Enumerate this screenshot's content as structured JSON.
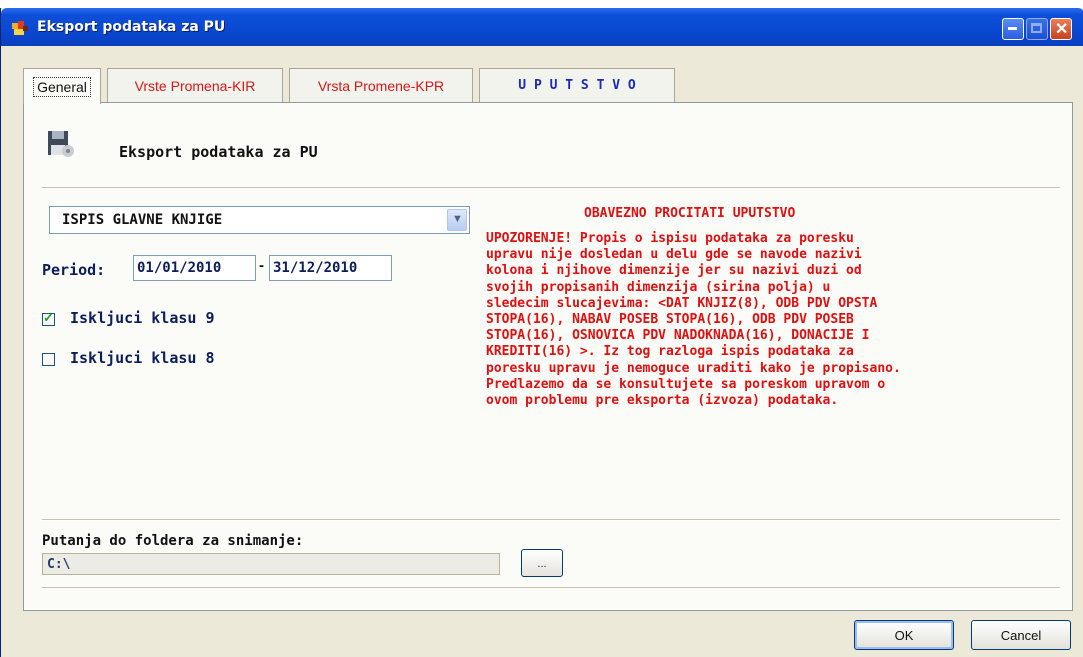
{
  "window": {
    "title": "Eksport podataka za PU"
  },
  "tabs": [
    {
      "label": "General",
      "color": "#111111"
    },
    {
      "label": "Vrste Promena-KIR",
      "color": "#d81818"
    },
    {
      "label": "Vrsta Promene-KPR",
      "color": "#d81818"
    },
    {
      "label": "U P U T S T V O",
      "color": "#1a2ab8"
    }
  ],
  "panel": {
    "heading": "Eksport podataka za PU",
    "report_select": {
      "selected": "ISPIS GLAVNE KNJIGE"
    },
    "period": {
      "label": "Period:",
      "from": "01/01/2010",
      "separator": "-",
      "to": "31/12/2010"
    },
    "exclude_class_9": {
      "label": "Iskljuci klasu 9",
      "checked": true
    },
    "exclude_class_8": {
      "label": "Iskljuci klasu 8",
      "checked": false
    },
    "warning": {
      "title": "OBAVEZNO PROCITATI UPUTSTVO",
      "text": "UPOZORENJE! Propis o ispisu podataka za poresku\nupravu nije dosledan u delu gde se navode nazivi\nkolona i njihove dimenzije jer su nazivi duzi od\nsvojih propisanih dimenzija (sirina polja) u\nsledecim slucajevima: <DAT KNJIZ(8), ODB PDV OPSTA\nSTOPA(16), NABAV POSEB STOPA(16), ODB PDV POSEB\nSTOPA(16), OSNOVICA PDV NADOKNADA(16), DONACIJE I\nKREDITI(16) >. Iz tog razloga ispis podataka za\nporesku upravu je nemoguce uraditi kako je propisano.\nPredlazemo da se konsultujete sa poreskom upravom o\novom problemu pre eksporta (izvoza) podataka.",
      "color": "#e01010"
    },
    "save_path": {
      "label": "Putanja do foldera za snimanje:",
      "value": "C:\\",
      "browse_label": "..."
    }
  },
  "buttons": {
    "ok": "OK",
    "cancel": "Cancel"
  }
}
